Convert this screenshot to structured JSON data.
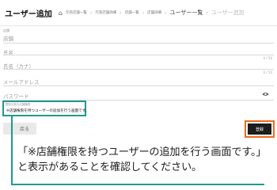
{
  "header": {
    "title": "ユーザー追加",
    "breadcrumb": [
      {
        "label": "元売店舗一覧",
        "size": "small"
      },
      {
        "label": "元売店舗詳細",
        "size": "small"
      },
      {
        "label": "店舗一覧",
        "size": "small"
      },
      {
        "label": "店舗詳細",
        "size": "small"
      },
      {
        "label": "ユーザー一覧",
        "size": "big"
      },
      {
        "label": "ユーザー追加",
        "size": "current"
      }
    ]
  },
  "form": {
    "store": {
      "caption": "店舗",
      "value": "店舗"
    },
    "name": {
      "label": "氏名",
      "counter": "0 / 50"
    },
    "name_kana": {
      "label": "氏名（カナ）",
      "counter": "0 / 50"
    },
    "email": {
      "label": "メールアドレス"
    },
    "password": {
      "label": "パスワード"
    },
    "notice": {
      "caption": "閲覧可能な店舗権限",
      "text": "※店舗権限を持つユーザーの追加を行う画面です。"
    }
  },
  "buttons": {
    "back": "戻る",
    "register": "登録"
  },
  "callout": {
    "line1": "「※店舗権限を持つユーザーの追加を行う画面です。」",
    "line2": "と表示があることを確認してください。"
  },
  "colors": {
    "notice_border": "#1e9a8e",
    "register_highlight": "#f06a1a",
    "register_button": "#1d1d1d"
  }
}
